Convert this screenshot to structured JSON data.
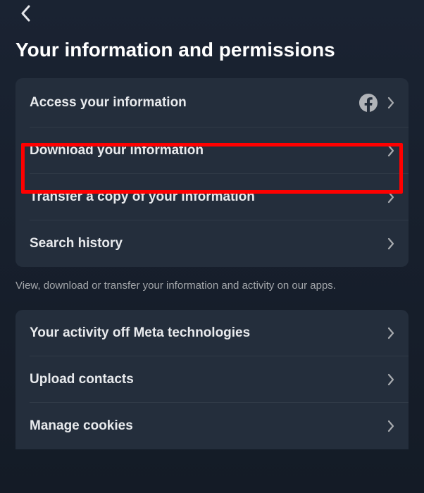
{
  "header": {
    "title": "Your information and permissions"
  },
  "section1": {
    "items": [
      {
        "label": "Access your information",
        "hasFacebookIcon": true
      },
      {
        "label": "Download your information",
        "highlighted": true
      },
      {
        "label": "Transfer a copy of your information"
      },
      {
        "label": "Search history"
      }
    ],
    "caption": "View, download or transfer your information and activity on our apps."
  },
  "section2": {
    "items": [
      {
        "label": "Your activity off Meta technologies"
      },
      {
        "label": "Upload contacts"
      },
      {
        "label": "Manage cookies"
      }
    ]
  }
}
